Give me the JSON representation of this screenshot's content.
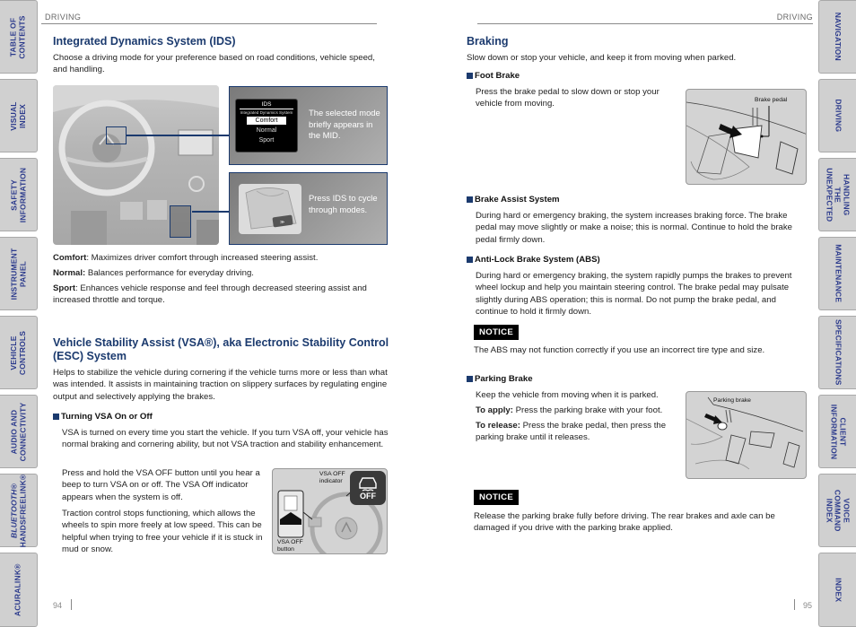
{
  "left_tabs": [
    {
      "label": "TABLE OF\nCONTENTS"
    },
    {
      "label": "VISUAL INDEX"
    },
    {
      "label": "SAFETY\nINFORMATION"
    },
    {
      "label": "INSTRUMENT\nPANEL"
    },
    {
      "label": "VEHICLE\nCONTROLS"
    },
    {
      "label": "AUDIO AND\nCONNECTIVITY"
    },
    {
      "label": "BLUETOOTH®\nHANDSFREELINK®"
    },
    {
      "label": "ACURALINK®"
    }
  ],
  "right_tabs": [
    {
      "label": "NAVIGATION"
    },
    {
      "label": "DRIVING"
    },
    {
      "label": "HANDLING THE\nUNEXPECTED"
    },
    {
      "label": "MAINTENANCE"
    },
    {
      "label": "SPECIFICATIONS"
    },
    {
      "label": "CLIENT\nINFORMATION"
    },
    {
      "label": "VOICE COMMAND\nINDEX"
    },
    {
      "label": "INDEX"
    }
  ],
  "left_page": {
    "running_head": "DRIVING",
    "page_number": "94",
    "ids": {
      "title": "Integrated Dynamics System (IDS)",
      "intro": "Choose a driving mode for your preference based on road conditions, vehicle speed, and handling.",
      "mid_display": {
        "title": "IDS",
        "subtitle": "Integrated Dynamics System",
        "options": [
          "Comfort",
          "Normal",
          "Sport"
        ],
        "selected": "Comfort"
      },
      "callout_mid": "The selected mode briefly appears in the MID.",
      "callout_button": "Press IDS to cycle through modes.",
      "modes": [
        {
          "name": "Comfort",
          "desc": " Maximizes driver comfort through increased steering assist."
        },
        {
          "name": "Normal:",
          "desc": " Balances performance for everyday driving."
        },
        {
          "name": "Sport",
          "desc": ": Enhances vehicle response and feel through decreased steering assist and increased throttle and torque."
        }
      ]
    },
    "vsa": {
      "title": "Vehicle Stability Assist (VSA®), aka Electronic Stability Control (ESC) System",
      "intro": "Helps to stabilize the vehicle during cornering if the vehicle turns more or less than what was intended. It assists in maintaining traction on slippery surfaces by regulating engine output and selectively applying the brakes.",
      "subhead": "Turning VSA On or Off",
      "para1": "VSA is turned on every time you start the vehicle. If you turn VSA off, your vehicle has normal braking and cornering ability, but not VSA traction and stability enhancement.",
      "para2": "Press and hold the VSA OFF button until you hear a beep to turn VSA on or off. The VSA Off indicator appears when the system is off.",
      "para3": "Traction control stops functioning, which allows the wheels to spin more freely at low speed. This can be helpful when trying to free your vehicle if it is stuck in mud or snow.",
      "fig_indicator_label": "VSA OFF\nindicator",
      "fig_button_label": "VSA OFF\nbutton",
      "fig_indicator_text": "OFF"
    }
  },
  "right_page": {
    "running_head": "DRIVING",
    "page_number": "95",
    "braking": {
      "title": "Braking",
      "intro": "Slow down or stop your vehicle, and keep it from moving when parked.",
      "foot_brake": {
        "subhead": "Foot Brake",
        "text": "Press the brake pedal to slow down or stop your vehicle from moving.",
        "fig_label": "Brake pedal"
      },
      "brake_assist": {
        "subhead": "Brake Assist System",
        "text": "During hard or emergency braking, the system increases braking force. The brake pedal may move slightly or make a noise; this is normal. Continue to hold the brake pedal firmly down."
      },
      "abs": {
        "subhead": "Anti-Lock Brake System (ABS)",
        "text": "During hard or emergency braking, the system rapidly pumps the brakes to prevent wheel lockup and help you maintain steering control. The brake pedal may pulsate slightly during ABS operation; this is normal. Do not pump the brake pedal, and continue to hold it firmly down.",
        "notice_label": "NOTICE",
        "notice_text": "The ABS may not function correctly if you use an incorrect tire type and size."
      },
      "parking_brake": {
        "subhead": "Parking Brake",
        "text": "Keep the vehicle from moving when it is parked.",
        "apply_label": "To apply:",
        "apply_text": " Press the parking brake with your foot.",
        "release_label": "To release:",
        "release_text": " Press the brake pedal, then press the parking brake until it releases.",
        "fig_label": "Parking brake",
        "notice_label": "NOTICE",
        "notice_text": "Release the parking brake fully before driving. The rear brakes and axle can be damaged if you drive with the parking brake applied."
      }
    }
  },
  "colors": {
    "heading_blue": "#1b3a6e",
    "tab_gray": "#d0d0d0",
    "tab_text": "#2b3a8c",
    "notice_bg": "#000000"
  }
}
